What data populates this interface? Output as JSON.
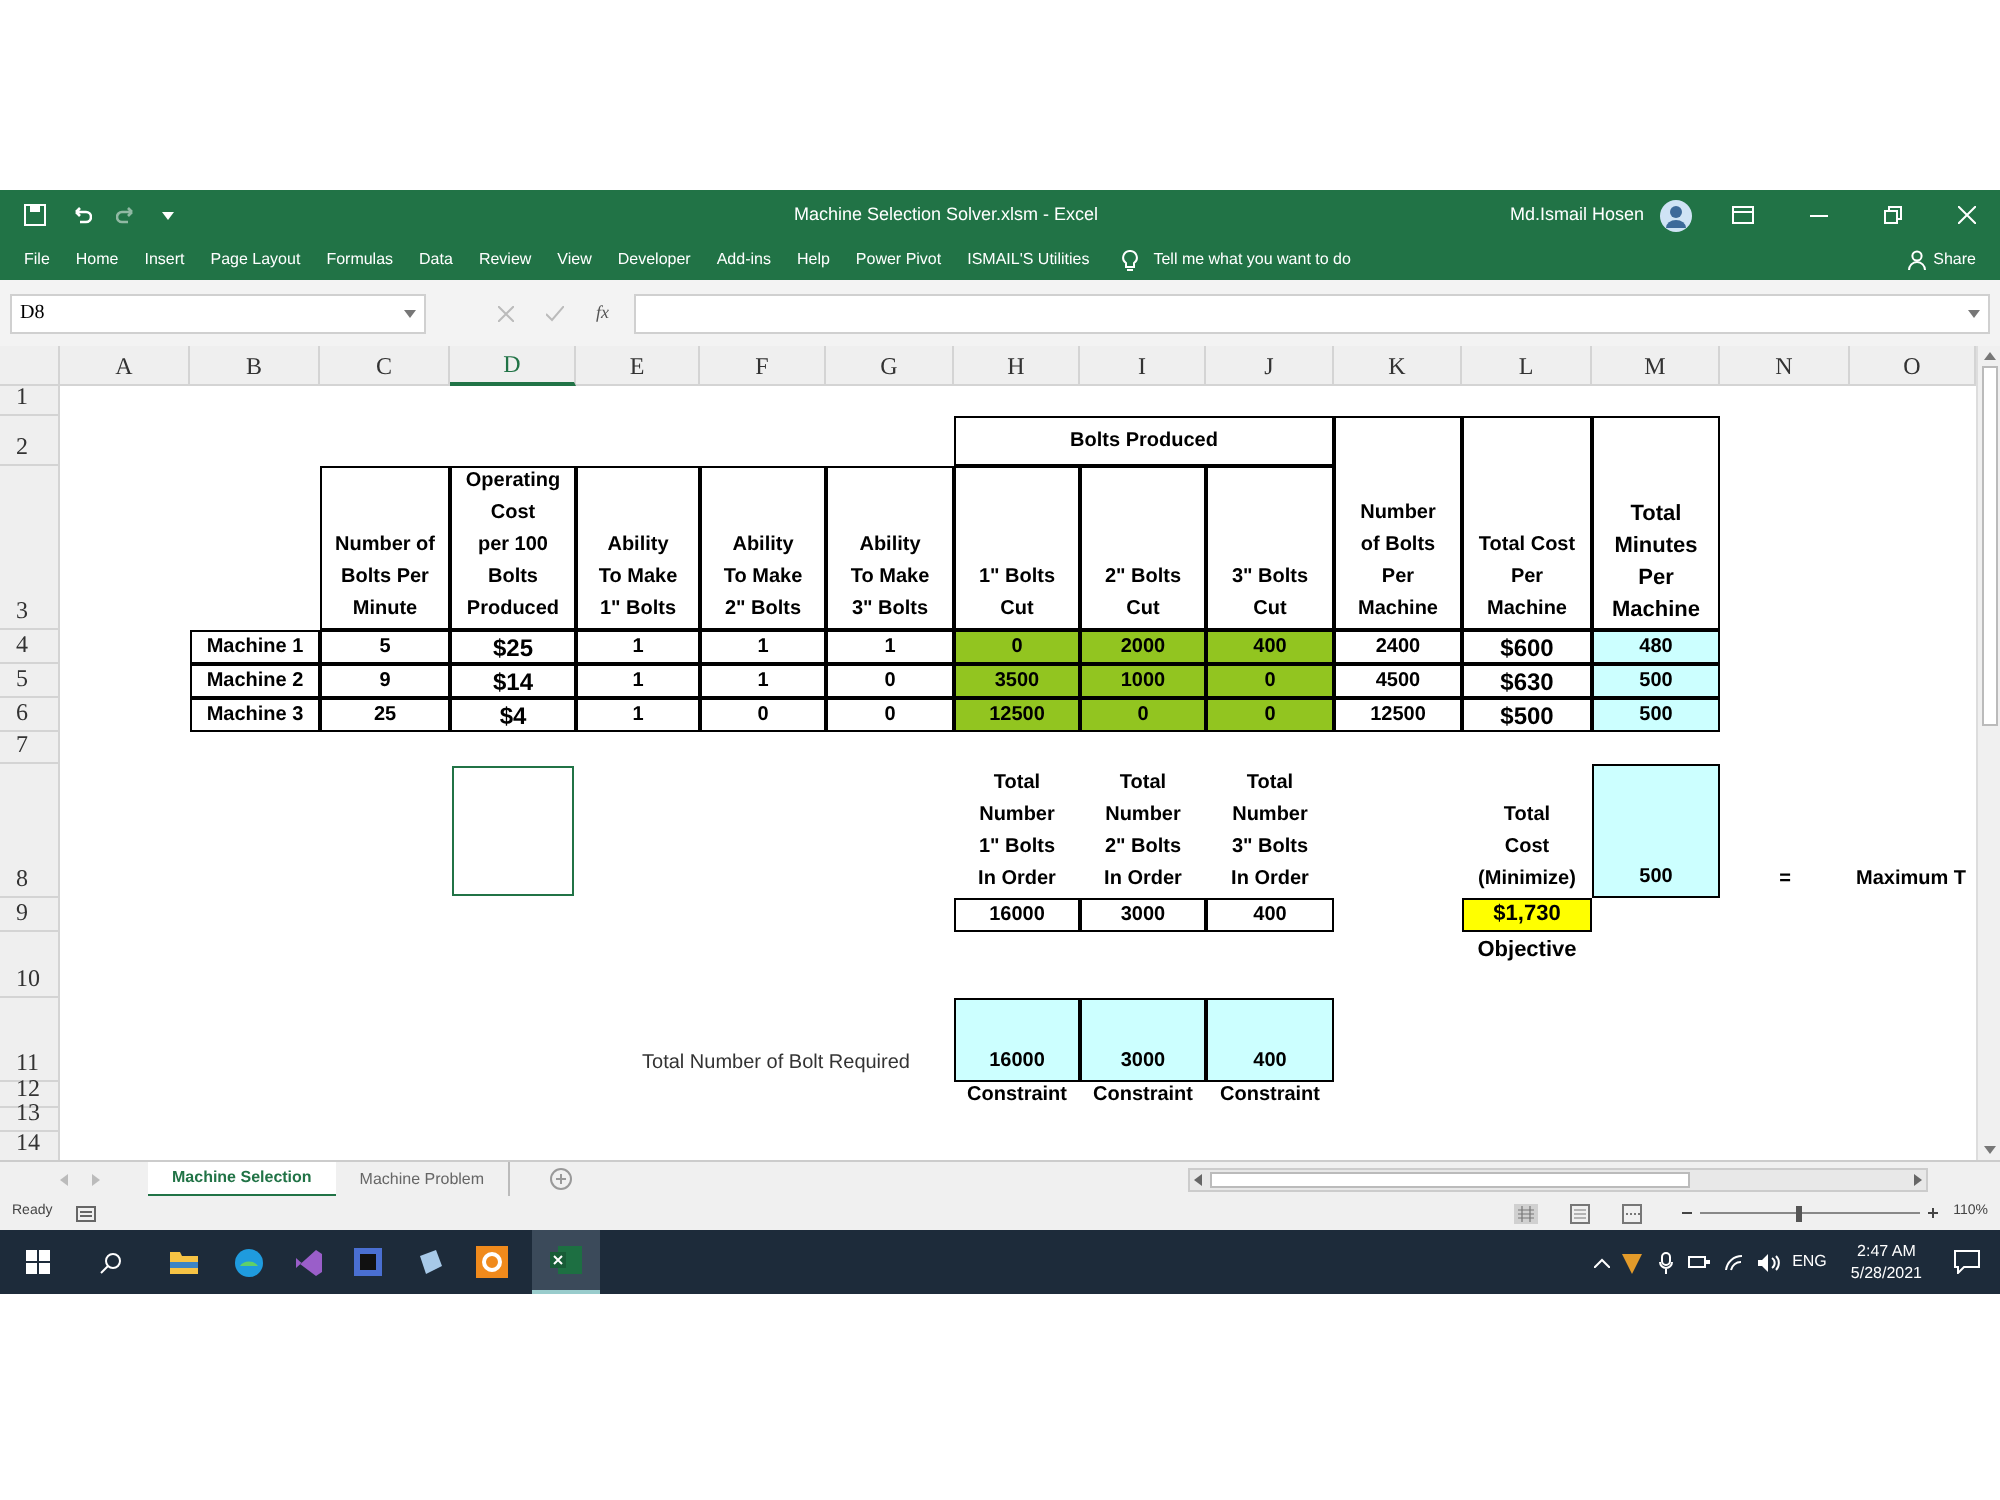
{
  "window": {
    "title": "Machine Selection Solver.xlsm  -  Excel",
    "user": "Md.Ismail Hosen"
  },
  "ribbon_tabs": [
    "File",
    "Home",
    "Insert",
    "Page Layout",
    "Formulas",
    "Data",
    "Review",
    "View",
    "Developer",
    "Add-ins",
    "Help",
    "Power Pivot",
    "ISMAIL'S Utilities"
  ],
  "tell_me": "Tell me what you want to do",
  "share": "Share",
  "formula_bar": {
    "name_box": "D8",
    "fx": "fx"
  },
  "columns": [
    {
      "label": "A",
      "selected": false
    },
    {
      "label": "B",
      "selected": false
    },
    {
      "label": "C",
      "selected": false
    },
    {
      "label": "D",
      "selected": true
    },
    {
      "label": "E",
      "selected": false
    },
    {
      "label": "F",
      "selected": false
    },
    {
      "label": "G",
      "selected": false
    },
    {
      "label": "H",
      "selected": false
    },
    {
      "label": "I",
      "selected": false
    },
    {
      "label": "J",
      "selected": false
    },
    {
      "label": "K",
      "selected": false
    },
    {
      "label": "L",
      "selected": false
    },
    {
      "label": "M",
      "selected": false
    },
    {
      "label": "N",
      "selected": false
    },
    {
      "label": "O",
      "selected": false
    }
  ],
  "rows": [
    "1",
    "2",
    "3",
    "4",
    "5",
    "6",
    "7",
    "8",
    "9",
    "10",
    "11",
    "12",
    "13",
    "14"
  ],
  "group_header": "Bolts Produced",
  "headers": [
    "Number of\nBolts Per\nMinute",
    "Operating\nCost\nper 100\nBolts\nProduced",
    "Ability\nTo Make\n1\" Bolts",
    "Ability\nTo Make\n2\" Bolts",
    "Ability\nTo Make\n3\" Bolts",
    "1\" Bolts\nCut",
    "2\" Bolts\nCut",
    "3\" Bolts\nCut",
    "Number\nof Bolts\nPer\nMachine",
    "Total Cost\nPer\nMachine",
    "Total\nMinutes\nPer\nMachine"
  ],
  "machines": [
    {
      "name": "Machine 1",
      "cells": [
        "5",
        "$25",
        "1",
        "1",
        "1",
        "0",
        "2000",
        "400",
        "2400",
        "$600",
        "480"
      ]
    },
    {
      "name": "Machine 2",
      "cells": [
        "9",
        "$14",
        "1",
        "1",
        "0",
        "3500",
        "1000",
        "0",
        "4500",
        "$630",
        "500"
      ]
    },
    {
      "name": "Machine 3",
      "cells": [
        "25",
        "$4",
        "1",
        "0",
        "0",
        "12500",
        "0",
        "0",
        "12500",
        "$500",
        "500"
      ]
    }
  ],
  "order_totals": {
    "labels": [
      "Total\nNumber\n1\" Bolts\nIn Order",
      "Total\nNumber\n2\" Bolts\nIn Order",
      "Total\nNumber\n3\" Bolts\nIn Order"
    ],
    "values": [
      "16000",
      "3000",
      "400"
    ]
  },
  "total_cost": {
    "label": "Total\nCost\n(Minimize)",
    "value": "$1,730",
    "caption": "Objective"
  },
  "max_minutes": {
    "value": "500",
    "equals": "=",
    "label": "Maximum T"
  },
  "required": {
    "label": "Total Number of Bolt Required",
    "values": [
      "16000",
      "3000",
      "400"
    ],
    "captions": [
      "Constraint",
      "Constraint",
      "Constraint"
    ]
  },
  "sheet_tabs": [
    {
      "label": "Machine Selection",
      "selected": true
    },
    {
      "label": "Machine Problem",
      "selected": false
    }
  ],
  "status": {
    "text": "Ready",
    "zoom": "110%"
  },
  "zoom_slider": {
    "level": 0.45
  },
  "taskbar": {
    "language": "ENG",
    "time": "2:47 AM",
    "date": "5/28/2021"
  }
}
